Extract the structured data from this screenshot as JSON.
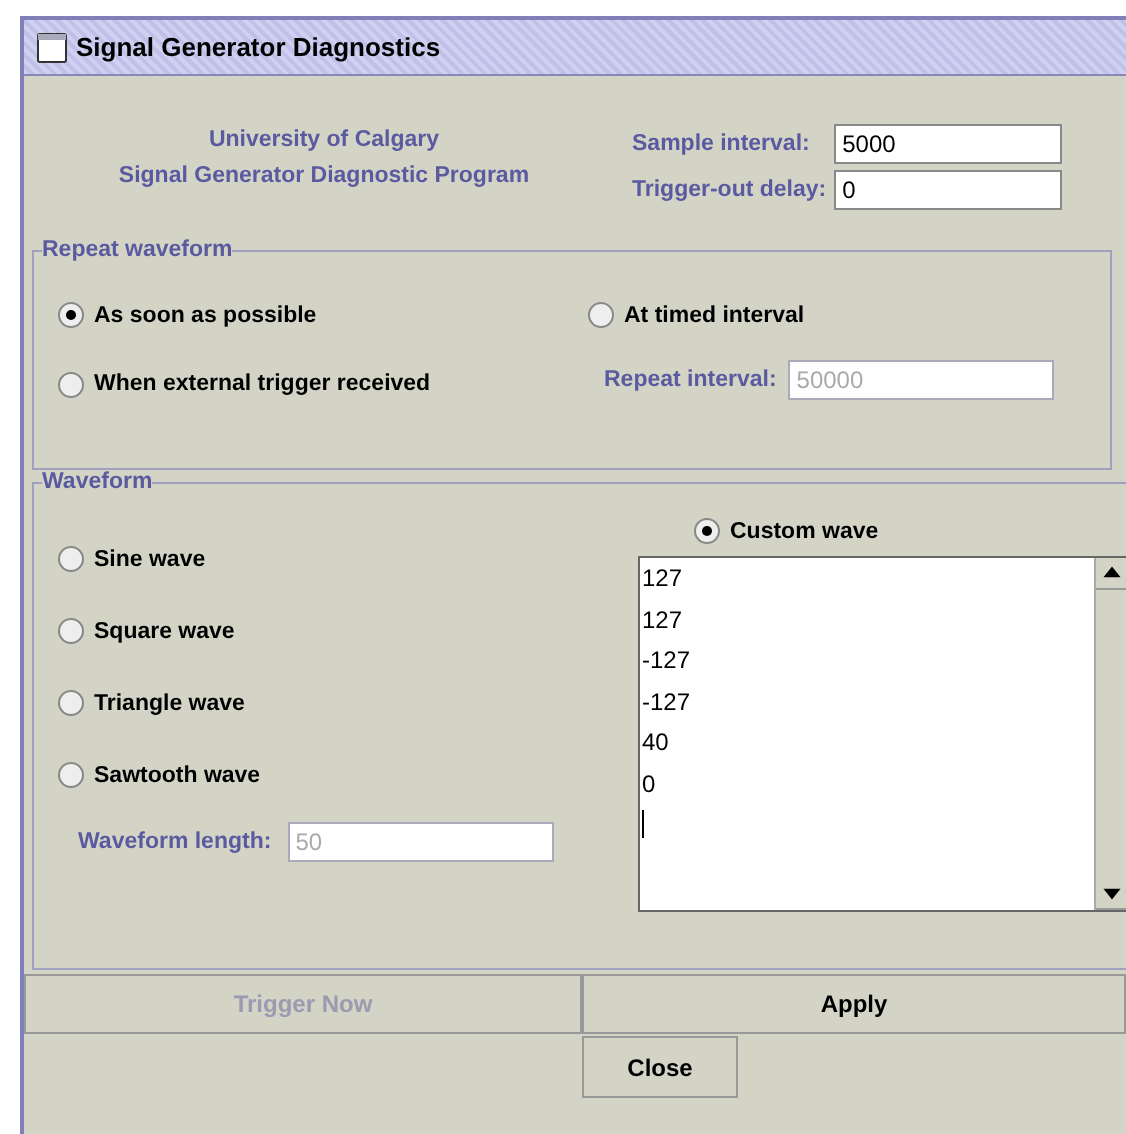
{
  "window": {
    "title": "Signal Generator Diagnostics"
  },
  "header": {
    "lines": [
      "University of Calgary",
      "Signal Generator Diagnostic Program"
    ]
  },
  "settings": [
    {
      "label": "Sample interval:",
      "value": "5000"
    },
    {
      "label": "Trigger-out delay:",
      "value": "0"
    }
  ],
  "repeat": {
    "title": "Repeat waveform",
    "options": [
      {
        "label": "As soon as possible",
        "selected": true
      },
      {
        "label": "At timed interval",
        "selected": false
      },
      {
        "label": "When external trigger received",
        "selected": false
      }
    ],
    "interval": {
      "label": "Repeat interval:",
      "value": "50000",
      "disabled": true
    }
  },
  "waveform": {
    "title": "Waveform",
    "options": [
      {
        "label": "Sine wave",
        "selected": false
      },
      {
        "label": "Square wave",
        "selected": false
      },
      {
        "label": "Triangle wave",
        "selected": false
      },
      {
        "label": "Sawtooth wave",
        "selected": false
      }
    ],
    "custom": {
      "label": "Custom wave",
      "selected": true
    },
    "values": [
      "127",
      "127",
      "-127",
      "-127",
      "40",
      "0"
    ],
    "length": {
      "label": "Waveform length:",
      "value": "50",
      "disabled": true
    }
  },
  "buttons": [
    {
      "label": "Trigger Now",
      "disabled": true
    },
    {
      "label": "Apply",
      "disabled": false
    },
    {
      "label": "Close",
      "disabled": false
    }
  ]
}
